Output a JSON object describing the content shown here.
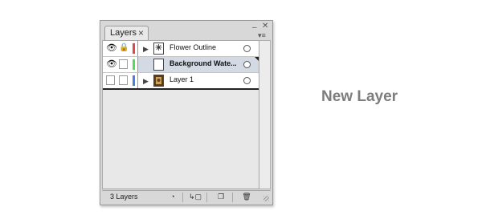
{
  "panel": {
    "tab_label": "Layers",
    "tab_close": "×",
    "minimize": "‒",
    "close": "✕",
    "menu": "▾≡"
  },
  "layers": [
    {
      "name": "Flower Outline",
      "visible": true,
      "locked": true,
      "color": "#e24848",
      "expandable": true,
      "selected": false,
      "thumbnail": "flower-icon"
    },
    {
      "name": "Background Wate...",
      "visible": true,
      "locked": false,
      "color": "#5ad85a",
      "expandable": false,
      "selected": true,
      "thumbnail": "blank"
    },
    {
      "name": "Layer 1",
      "visible": false,
      "locked": false,
      "color": "#4a7fe0",
      "expandable": true,
      "selected": false,
      "thumbnail": "image-icon"
    }
  ],
  "footer": {
    "count_label": "3 Layers",
    "buttons": [
      "make-clipping-mask",
      "create-sublayer",
      "create-layer",
      "delete"
    ]
  },
  "heading": "New Layer"
}
